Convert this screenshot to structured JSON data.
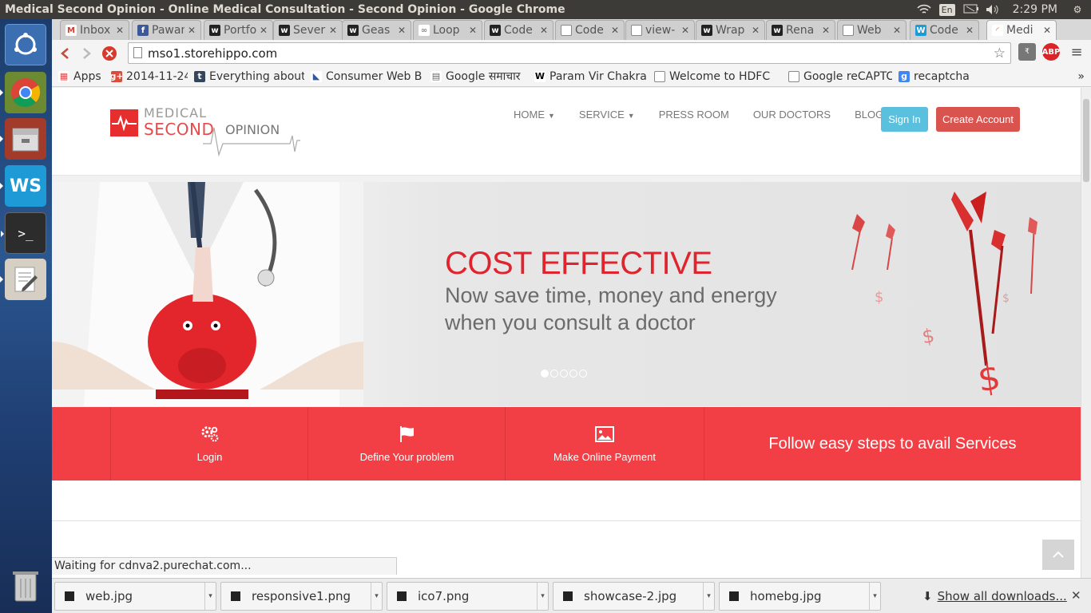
{
  "os": {
    "window_title": "Medical Second Opinion - Online Medical Consultation - Second Opinion - Google Chrome",
    "lang_indicator": "En",
    "clock": "2:29 PM"
  },
  "tabs": [
    {
      "label": "Inbox",
      "icon": "gmail-icon"
    },
    {
      "label": "Pawan",
      "icon": "facebook-icon"
    },
    {
      "label": "Portfo",
      "icon": "w-icon"
    },
    {
      "label": "Severa",
      "icon": "w-icon"
    },
    {
      "label": "Geas",
      "icon": "w-icon"
    },
    {
      "label": "Loop",
      "icon": "loop-icon"
    },
    {
      "label": "Code",
      "icon": "w-icon"
    },
    {
      "label": "Code",
      "icon": "page-icon"
    },
    {
      "label": "view-",
      "icon": "page-icon"
    },
    {
      "label": "Wrap",
      "icon": "w-icon"
    },
    {
      "label": "Rena",
      "icon": "w-icon"
    },
    {
      "label": "Web",
      "icon": "page-icon"
    },
    {
      "label": "Code",
      "icon": "ws-icon"
    },
    {
      "label": "Medi",
      "icon": "loading-icon"
    }
  ],
  "address_bar": {
    "url": "mso1.storehippo.com"
  },
  "bookmarks": [
    {
      "label": "Apps",
      "icon": "apps-icon"
    },
    {
      "label": "2014-11-24",
      "icon": "gplus-icon"
    },
    {
      "label": "Everything about",
      "icon": "tumblr-icon"
    },
    {
      "label": "Consumer Web B",
      "icon": "chart-icon"
    },
    {
      "label": "Google समाचार",
      "icon": "news-icon"
    },
    {
      "label": "Param Vir Chakra",
      "icon": "wikipedia-icon"
    },
    {
      "label": "Welcome to HDFC",
      "icon": "page-icon"
    },
    {
      "label": "Google reCAPTCH",
      "icon": "page-icon"
    },
    {
      "label": "recaptcha",
      "icon": "google-icon"
    }
  ],
  "site": {
    "logo": {
      "line1": "MEDICAL",
      "line2": "SECOND",
      "line3": "OPINION"
    },
    "nav": [
      {
        "label": "HOME",
        "caret": true
      },
      {
        "label": "SERVICE",
        "caret": true
      },
      {
        "label": "PRESS ROOM",
        "caret": false
      },
      {
        "label": "OUR DOCTORS",
        "caret": false
      },
      {
        "label": "BLOG",
        "caret": false
      }
    ],
    "sign_in": "Sign In",
    "create_account": "Create Account",
    "hero": {
      "heading": "COST EFFECTIVE",
      "subtext": "Now save time, money and energy when you consult a doctor",
      "slide_count": 5,
      "active_slide": 1
    },
    "steps": [
      {
        "label": "Login",
        "icon": "gears-icon"
      },
      {
        "label": "Define Your problem",
        "icon": "flag-icon"
      },
      {
        "label": "Make Online Payment",
        "icon": "image-icon"
      }
    ],
    "steps_tagline": "Follow easy steps to avail Services"
  },
  "status_text": "Waiting for cdnva2.purechat.com...",
  "downloads": [
    {
      "name": "web.jpg"
    },
    {
      "name": "responsive1.png"
    },
    {
      "name": "ico7.png"
    },
    {
      "name": "showcase-2.jpg"
    },
    {
      "name": "homebg.jpg"
    }
  ],
  "show_all_downloads": "Show all downloads...",
  "colors": {
    "brand_red": "#f23f45",
    "signin_blue": "#5bc0de",
    "create_red": "#d9534f"
  }
}
